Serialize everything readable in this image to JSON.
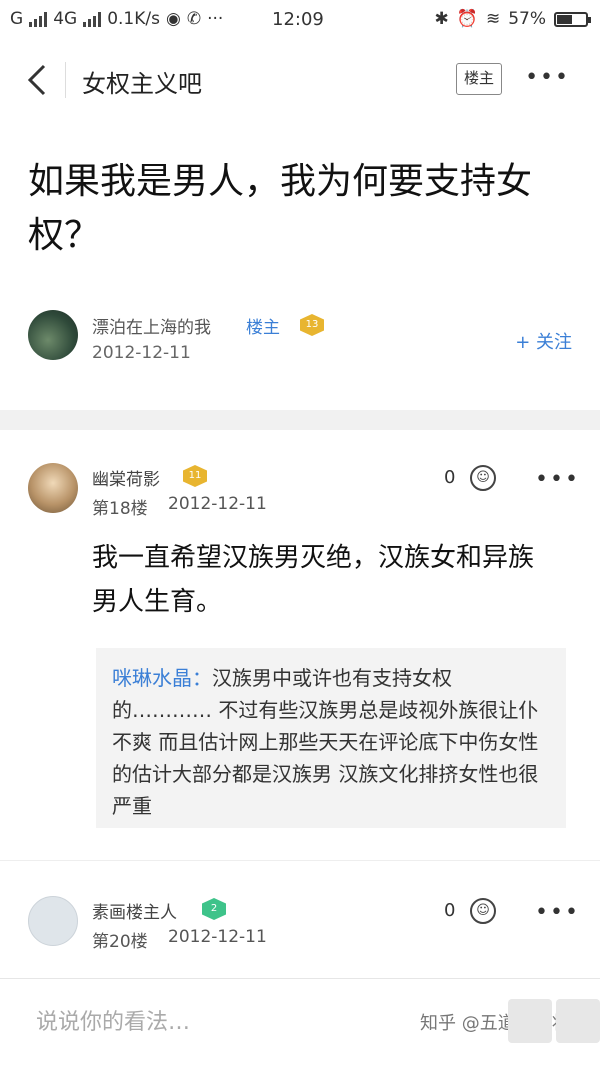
{
  "status_bar": {
    "carrier_left": "G",
    "network": "4G",
    "speed": "0.1K/s",
    "weibo_icon": "weibo-icon",
    "phone_icon": "phone-icon",
    "more": "···",
    "time": "12:09",
    "battery_percent": "57%",
    "battery_level": 0.57
  },
  "header": {
    "forum_name": "女权主义吧",
    "owner_only_label": "楼主"
  },
  "post": {
    "title": "如果我是男人，我为何要支持女权？",
    "author": {
      "name": "漂泊在上海的我",
      "tag": "楼主",
      "level": "13",
      "date": "2012-12-11"
    },
    "follow_label": "+ 关注"
  },
  "replies": [
    {
      "name": "幽棠荷影",
      "level": "11",
      "floor": "第18楼",
      "date": "2012-12-11",
      "likes": "0",
      "body": "我一直希望汉族男灭绝，汉族女和异族男人生育。",
      "quote": {
        "author": "咪琳水晶：",
        "text": "汉族男中或许也有支持女权的………… 不过有些汉族男总是歧视外族很让仆不爽 而且估计网上那些天天在评论底下中伤女性的估计大部分都是汉族男 汉族文化排挤女性也很严重"
      }
    },
    {
      "name": "素画楼主人",
      "level": "2",
      "floor": "第20楼",
      "date": "2012-12-11",
      "likes": "0"
    }
  ],
  "bottom_bar": {
    "comment_placeholder": "说说你的看法…",
    "watermark": "知乎 @五道杠大将军"
  },
  "colors": {
    "accent_blue": "#3b7fd6",
    "badge_gold": "#e8b530",
    "badge_green": "#3ec38a",
    "section_gap": "#f1f1f1"
  }
}
